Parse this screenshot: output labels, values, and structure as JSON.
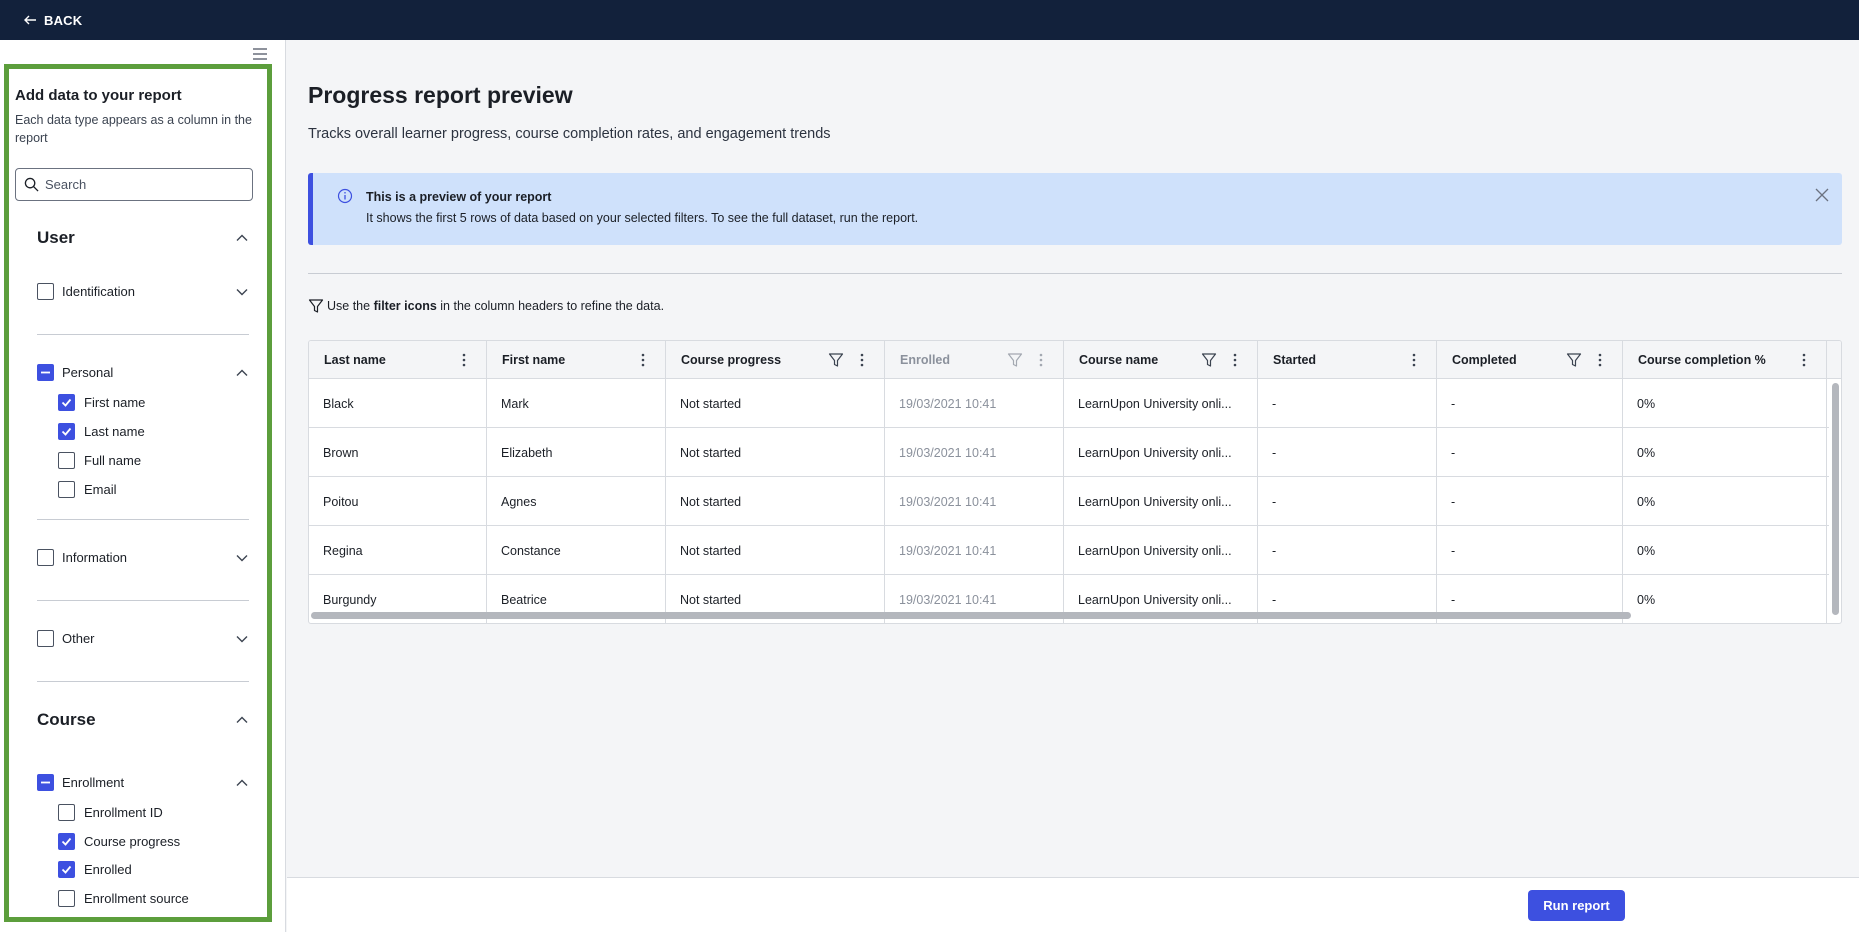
{
  "topbar": {
    "back_label": "BACK",
    "back_icon": "arrow-left-icon",
    "bg": "#12213b"
  },
  "sidebar": {
    "title": "Add data to your report",
    "description": "Each data type appears as a column in the report",
    "search_placeholder": "Search",
    "highlight_color": "#5c9e3c",
    "sections": {
      "user": {
        "label": "User",
        "expanded": true,
        "groups": {
          "identification": {
            "label": "Identification",
            "state": "unchecked",
            "expanded": false
          },
          "personal": {
            "label": "Personal",
            "state": "partial",
            "expanded": true,
            "items": [
              {
                "label": "First name",
                "checked": true
              },
              {
                "label": "Last name",
                "checked": true
              },
              {
                "label": "Full name",
                "checked": false
              },
              {
                "label": "Email",
                "checked": false
              }
            ]
          },
          "information": {
            "label": "Information",
            "state": "unchecked",
            "expanded": false
          },
          "other": {
            "label": "Other",
            "state": "unchecked",
            "expanded": false
          }
        }
      },
      "course": {
        "label": "Course",
        "expanded": true,
        "groups": {
          "enrollment": {
            "label": "Enrollment",
            "state": "partial",
            "expanded": true,
            "items": [
              {
                "label": "Enrollment ID",
                "checked": false
              },
              {
                "label": "Course progress",
                "checked": true
              },
              {
                "label": "Enrolled",
                "checked": true
              },
              {
                "label": "Enrollment source",
                "checked": false
              }
            ]
          }
        }
      }
    }
  },
  "main": {
    "title": "Progress report preview",
    "subtitle": "Tracks overall learner progress, course completion rates, and engagement trends",
    "banner": {
      "title": "This is a preview of your report",
      "text": "It shows the first 5 rows of data based on your selected filters. To see the full dataset, run the report.",
      "bg": "#cfe1fb",
      "accent": "#3d50e0"
    },
    "hint": {
      "before": "Use the ",
      "bold": "filter icons",
      "after": " in the column headers to refine the data."
    },
    "table": {
      "columns": [
        {
          "label": "Last name",
          "filter": false,
          "disabled": false
        },
        {
          "label": "First name",
          "filter": false,
          "disabled": false
        },
        {
          "label": "Course progress",
          "filter": true,
          "disabled": false
        },
        {
          "label": "Enrolled",
          "filter": true,
          "disabled": true
        },
        {
          "label": "Course name",
          "filter": true,
          "disabled": false
        },
        {
          "label": "Started",
          "filter": false,
          "disabled": false
        },
        {
          "label": "Completed",
          "filter": true,
          "disabled": false
        },
        {
          "label": "Course completion %",
          "filter": false,
          "disabled": false
        }
      ],
      "rows": [
        [
          "Black",
          "Mark",
          "Not started",
          "19/03/2021 10:41",
          "LearnUpon University onli...",
          "-",
          "-",
          "0%"
        ],
        [
          "Brown",
          "Elizabeth",
          "Not started",
          "19/03/2021 10:41",
          "LearnUpon University onli...",
          "-",
          "-",
          "0%"
        ],
        [
          "Poitou",
          "Agnes",
          "Not started",
          "19/03/2021 10:41",
          "LearnUpon University onli...",
          "-",
          "-",
          "0%"
        ],
        [
          "Regina",
          "Constance",
          "Not started",
          "19/03/2021 10:41",
          "LearnUpon University onli...",
          "-",
          "-",
          "0%"
        ],
        [
          "Burgundy",
          "Beatrice",
          "Not started",
          "19/03/2021 10:41",
          "LearnUpon University onli...",
          "-",
          "-",
          "0%"
        ]
      ]
    },
    "run_button": "Run report"
  }
}
